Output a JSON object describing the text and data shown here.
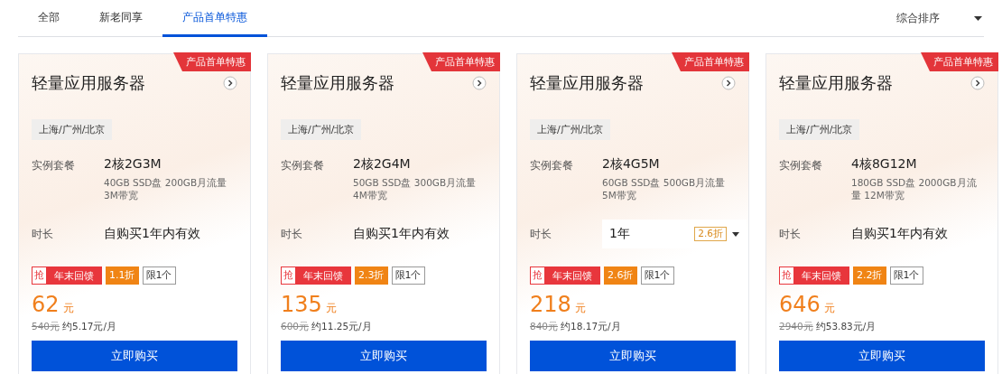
{
  "tabs": [
    {
      "label": "全部",
      "selected": false
    },
    {
      "label": "新老同享",
      "selected": false
    },
    {
      "label": "产品首单特惠",
      "selected": true
    }
  ],
  "sort": {
    "label": "综合排序"
  },
  "cards": [
    {
      "corner_tag": "产品首单特惠",
      "title": "轻量应用服务器",
      "region": "上海/广州/北京",
      "spec_label": "实例套餐",
      "spec": "2核2G3M",
      "spec_detail": "40GB SSD盘 200GB月流量 3M带宽",
      "duration_label": "时长",
      "duration": {
        "kind": "text",
        "value": "自购买1年内有效"
      },
      "grab": "抢",
      "promo": "年末回馈",
      "discount": "1.1折",
      "limit": "限1个",
      "price": "62",
      "unit": "元",
      "original": "540元",
      "monthly": "约5.17元/月",
      "buy": "立即购买"
    },
    {
      "corner_tag": "产品首单特惠",
      "title": "轻量应用服务器",
      "region": "上海/广州/北京",
      "spec_label": "实例套餐",
      "spec": "2核2G4M",
      "spec_detail": "50GB SSD盘 300GB月流量 4M带宽",
      "duration_label": "时长",
      "duration": {
        "kind": "text",
        "value": "自购买1年内有效"
      },
      "grab": "抢",
      "promo": "年末回馈",
      "discount": "2.3折",
      "limit": "限1个",
      "price": "135",
      "unit": "元",
      "original": "600元",
      "monthly": "约11.25元/月",
      "buy": "立即购买"
    },
    {
      "corner_tag": "产品首单特惠",
      "title": "轻量应用服务器",
      "region": "上海/广州/北京",
      "spec_label": "实例套餐",
      "spec": "2核4G5M",
      "spec_detail": "60GB SSD盘 500GB月流量 5M带宽",
      "duration_label": "时长",
      "duration": {
        "kind": "select",
        "value": "1年",
        "badge": "2.6折"
      },
      "grab": "抢",
      "promo": "年末回馈",
      "discount": "2.6折",
      "limit": "限1个",
      "price": "218",
      "unit": "元",
      "original": "840元",
      "monthly": "约18.17元/月",
      "buy": "立即购买"
    },
    {
      "corner_tag": "产品首单特惠",
      "title": "轻量应用服务器",
      "region": "上海/广州/北京",
      "spec_label": "实例套餐",
      "spec": "4核8G12M",
      "spec_detail": "180GB SSD盘 2000GB月流量 12M带宽",
      "duration_label": "时长",
      "duration": {
        "kind": "text",
        "value": "自购买1年内有效"
      },
      "grab": "抢",
      "promo": "年末回馈",
      "discount": "2.2折",
      "limit": "限1个",
      "price": "646",
      "unit": "元",
      "original": "2940元",
      "monthly": "约53.83元/月",
      "buy": "立即购买"
    }
  ]
}
